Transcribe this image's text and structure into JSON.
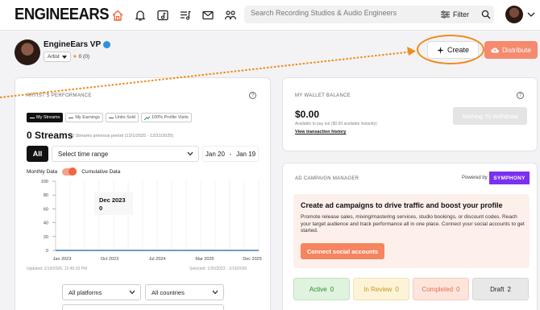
{
  "header": {
    "logo": "ENGINEEARS",
    "search_placeholder": "Search Recording Studios & Audio Engineers",
    "filter_label": "Filter"
  },
  "profile": {
    "name": "EngineEars VP",
    "role": "Artist",
    "rating": "0 (0)",
    "create_label": "Create",
    "distribute_label": "Distribute"
  },
  "performance": {
    "title": "ARTIST'S PERFORMANCE",
    "tabs": [
      "My Streams",
      "My Earnings",
      "Units Sold",
      "100% Profile Visits"
    ],
    "streams_title": "0 Streams",
    "streams_sub": "0 Streams previous period (12/1/2025 - 12/31/2025)",
    "all_label": "All",
    "time_range_placeholder": "Select time range",
    "date_from": "Jan 20",
    "date_sep": "-",
    "date_to": "Jan 19",
    "monthly_label": "Monthly Data",
    "cumulative_label": "Cumulative Data",
    "tooltip_date": "Dec 2023",
    "tooltip_value": "0",
    "updated_text": "Updated: 1/19/2026, 12:45:33 PM",
    "selected_text": "Selected: 1/20/2023 - 1/19/2026",
    "platforms_label": "All platforms",
    "countries_label": "All countries"
  },
  "chart_data": {
    "type": "line",
    "x": [
      "Jan 2023",
      "Oct 2023",
      "Jul 2024",
      "Mar 2025",
      "Dec 2025"
    ],
    "y_ticks": [
      0,
      20,
      40,
      60,
      80,
      100
    ],
    "ylim": [
      0,
      100
    ],
    "series": [
      {
        "values": [
          0,
          0,
          0,
          0,
          0
        ]
      }
    ],
    "grid": true
  },
  "wallet": {
    "title": "MY WALLET BALANCE",
    "amount": "$0.00",
    "sub": "Available to pay out ($0.00 available instantly)",
    "link": "View transaction history",
    "withdraw_label": "Nothing To Withdraw"
  },
  "ads": {
    "title": "AD CAMPAIGN MANAGER",
    "powered_by": "Powered by",
    "brand": "SYMPHONY",
    "heading": "Create ad campaigns to drive traffic and boost your profile",
    "desc": "Promote release sales, mixing/mastering services, studio bookings, or discount codes. Reach your target audience and track performance all in one place. Connect your social accounts to get started.",
    "connect_label": "Connect social accounts",
    "stats": {
      "active_label": "Active",
      "active_count": "0",
      "review_label": "In Review",
      "review_count": "0",
      "completed_label": "Completed",
      "completed_count": "0",
      "draft_label": "Draft",
      "draft_count": "2"
    }
  },
  "colors": {
    "accent": "#f5845f",
    "annotation": "#f08a1a",
    "brand_purple": "#7b2ff0",
    "home_icon": "#f0663e"
  }
}
